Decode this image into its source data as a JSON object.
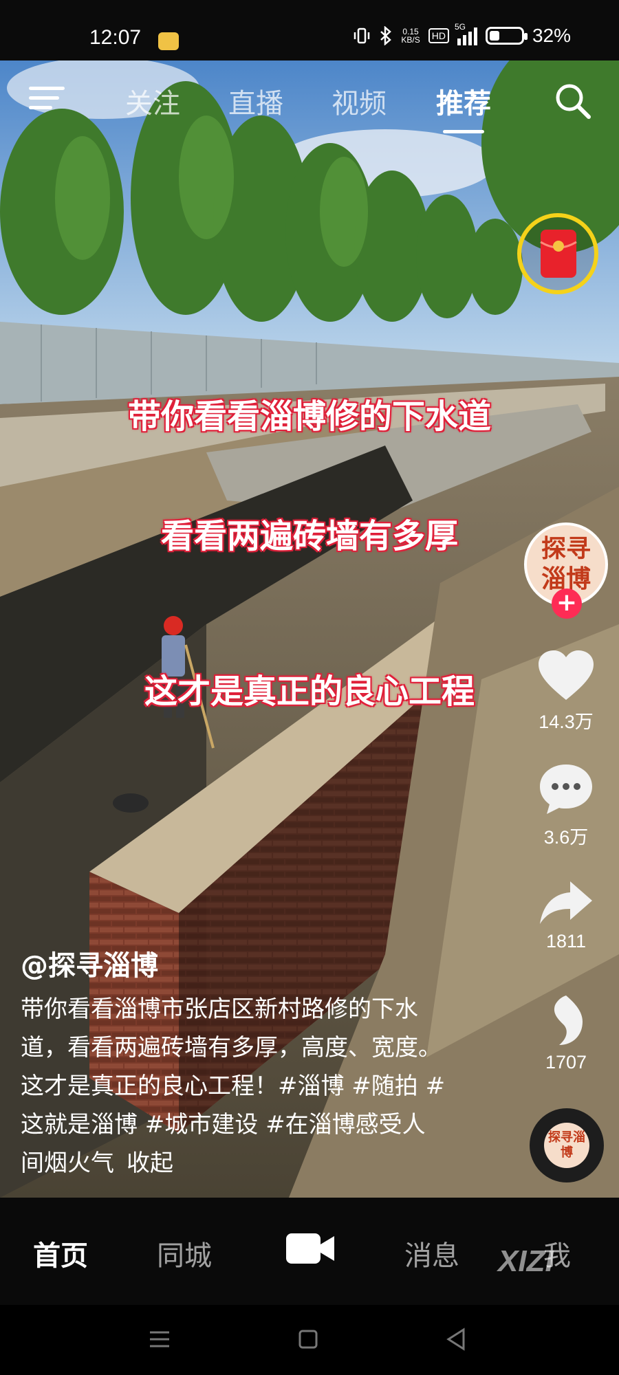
{
  "status_bar": {
    "time": "12:07",
    "network_speed_top": "0.15",
    "network_speed_unit": "KB/S",
    "hd": "HD",
    "network": "5G",
    "battery": "32%",
    "battery_level": 0.32
  },
  "top_nav": {
    "tabs": [
      {
        "label": "关注",
        "active": false
      },
      {
        "label": "直播",
        "active": false
      },
      {
        "label": "视频",
        "active": false
      },
      {
        "label": "推荐",
        "active": true
      }
    ]
  },
  "captions": [
    "带你看看淄博修的下水道",
    "看看两遍砖墙有多厚",
    "这才是真正的良心工程"
  ],
  "right_rail": {
    "avatar_text": "探寻淄博",
    "like_count": "14.3万",
    "comment_count": "3.6万",
    "share_count": "1811",
    "favorite_count": "1707",
    "music_disc_text": "探寻淄博"
  },
  "post": {
    "author": "@探寻淄博",
    "description": "带你看看淄博市张店区新村路修的下水道，看看两遍砖墙有多厚，高度、宽度。这才是真正的良心工程！#淄博 #随拍 #这就是淄博 #城市建设 #在淄博感受人间烟火气",
    "collapse_label": "收起"
  },
  "bottom_nav": {
    "tabs": [
      {
        "label": "首页",
        "active": true
      },
      {
        "label": "同城",
        "active": false
      },
      {
        "label": "消息",
        "active": false
      },
      {
        "label": "我",
        "active": false
      }
    ]
  },
  "watermark": "XIZI",
  "colors": {
    "accent": "#fe2c55",
    "caption_outline": "#e0203a",
    "red_packet_ring": "#f5d21a"
  }
}
